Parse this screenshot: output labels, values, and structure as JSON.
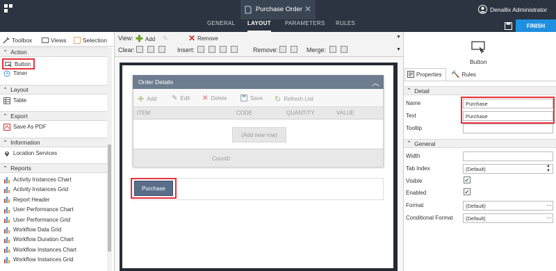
{
  "app": {
    "title": "Purchase Order",
    "nav_tabs": [
      "GENERAL",
      "LAYOUT",
      "PARAMETERS",
      "RULES"
    ],
    "active_tab": "LAYOUT",
    "user": "Denallix Administrator",
    "finish_label": "FINISH"
  },
  "left": {
    "tabs": [
      "Toolbox",
      "Views",
      "Selection"
    ],
    "sections": {
      "action": "Action",
      "layout": "Layout",
      "export": "Export",
      "information": "Information",
      "reports": "Reports"
    },
    "action_items": [
      "Button",
      "Timer"
    ],
    "layout_items": [
      "Table"
    ],
    "export_items": [
      "Save As PDF"
    ],
    "information_items": [
      "Location Services"
    ],
    "report_items": [
      "Activity Instances Chart",
      "Activity Instances Grid",
      "Report Header",
      "User Performance Chart",
      "User Performance Grid",
      "Workflow Data Grid",
      "Workflow Duration Chart",
      "Workflow Instances Chart",
      "Workflow Instances Grid"
    ]
  },
  "center": {
    "view_label": "View:",
    "add_label": "Add",
    "remove_label": "Remove",
    "clear_label": "Clear:",
    "insert_label": "Insert:",
    "remove2_label": "Remove:",
    "merge_label": "Merge:",
    "grid": {
      "title": "Order Details",
      "tools": [
        "Add",
        "Edit",
        "Delete",
        "Save",
        "Refresh List"
      ],
      "columns": [
        "ITEM",
        "CODE",
        "QUANTITY",
        "VALUE"
      ],
      "add_row": "(Add new row)",
      "count": "Count0"
    },
    "button_text": "Purchase"
  },
  "right": {
    "control_name": "Button",
    "tabs": [
      "Properties",
      "Rules"
    ],
    "detail_header": "Detail",
    "general_header": "General",
    "props": {
      "name_label": "Name",
      "name_value": "Purchase",
      "text_label": "Text",
      "text_value": "Purchase",
      "tooltip_label": "Tooltip",
      "tooltip_value": "",
      "width_label": "Width",
      "width_value": "",
      "tabindex_label": "Tab Index",
      "tabindex_value": "(Default)",
      "visible_label": "Visible",
      "enabled_label": "Enabled",
      "format_label": "Format",
      "format_value": "(Default)",
      "condformat_label": "Conditional Format",
      "condformat_value": "(Default)"
    }
  },
  "colors": {
    "topbar": "#2b3440",
    "accent": "#1e8fe1",
    "highlight": "#e8303a",
    "grid_header": "#6d7c8f",
    "button": "#5a6e8a"
  }
}
